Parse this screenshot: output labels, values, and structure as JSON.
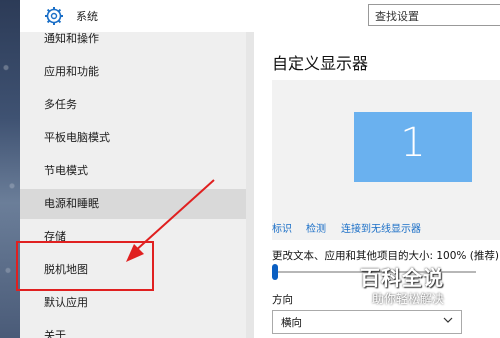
{
  "app": {
    "title": "系统"
  },
  "search": {
    "placeholder": "查找设置"
  },
  "sidebar": {
    "items": [
      {
        "label": "通知和操作"
      },
      {
        "label": "应用和功能"
      },
      {
        "label": "多任务"
      },
      {
        "label": "平板电脑模式"
      },
      {
        "label": "节电模式"
      },
      {
        "label": "电源和睡眠"
      },
      {
        "label": "存储"
      },
      {
        "label": "脱机地图"
      },
      {
        "label": "默认应用"
      },
      {
        "label": "关于"
      }
    ]
  },
  "main": {
    "title": "自定义显示器",
    "monitor_number": "1",
    "links": {
      "identify": "标识",
      "detect": "检测",
      "wireless": "连接到无线显示器"
    },
    "scale_label": "更改文本、应用和其他项目的大小: 100% (推荐)",
    "orientation_label": "方向",
    "orientation_value": "横向"
  },
  "watermark": {
    "main": "百科全说",
    "sub": "助你轻松解决"
  },
  "colors": {
    "accent": "#0a5fc2",
    "monitor": "#6ab1ef",
    "annotation": "#e02020"
  }
}
